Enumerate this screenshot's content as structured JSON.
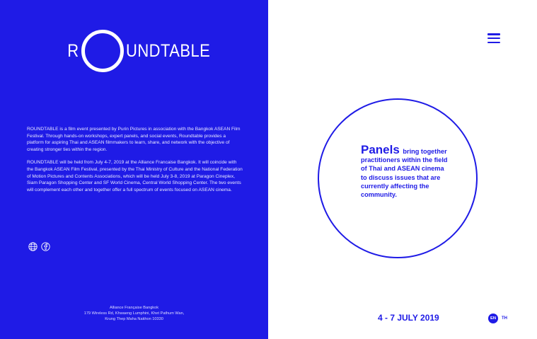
{
  "brand": {
    "logo_left": "R",
    "logo_right": "UNDTABLE"
  },
  "about": {
    "paragraph1": "ROUNDTABLE is a film event presented by Purin Pictures in association with the Bangkok ASEAN Film Festival. Through hands-on workshops, expert panels, and social events, Roundtable provides a platform for aspiring Thai and ASEAN filmmakers to learn, share, and network with the objective of creating stronger ties within the region.",
    "paragraph2": "ROUNDTABLE will be held from July 4-7, 2019 at the Alliance Francaise Bangkok. It will coincide with the Bangkok ASEAN Film Festival, presented by the Thai Ministry of Culture and the National Federation of Motion Pictures and Contents Associations, which will be held July 3-8, 2019 at Paragon Cineplex, Siam Paragon Shopping Center and SF World Cinema, Central World Shopping Center. The two events will complement each other and together offer a full spectrum of events focused on ASEAN cinema."
  },
  "social": {
    "icons": [
      "globe-icon",
      "facebook-icon"
    ]
  },
  "address": {
    "line1": "Alliance Française Bangkok",
    "line2": "179 Wireless Rd, Khwaeng Lumphini, Khet Pathum Wan,",
    "line3": "Krung Thep Maha Nakhon 10330"
  },
  "panel": {
    "title": "Panels",
    "description": "bring together practitioners within the field of Thai and ASEAN cinema to discuss issues that are currently affecting the community."
  },
  "event": {
    "dates": "4 - 7 JULY 2019"
  },
  "language": {
    "en": "EN",
    "th": "TH"
  },
  "colors": {
    "brand_blue": "#1f1be6",
    "white": "#ffffff"
  }
}
